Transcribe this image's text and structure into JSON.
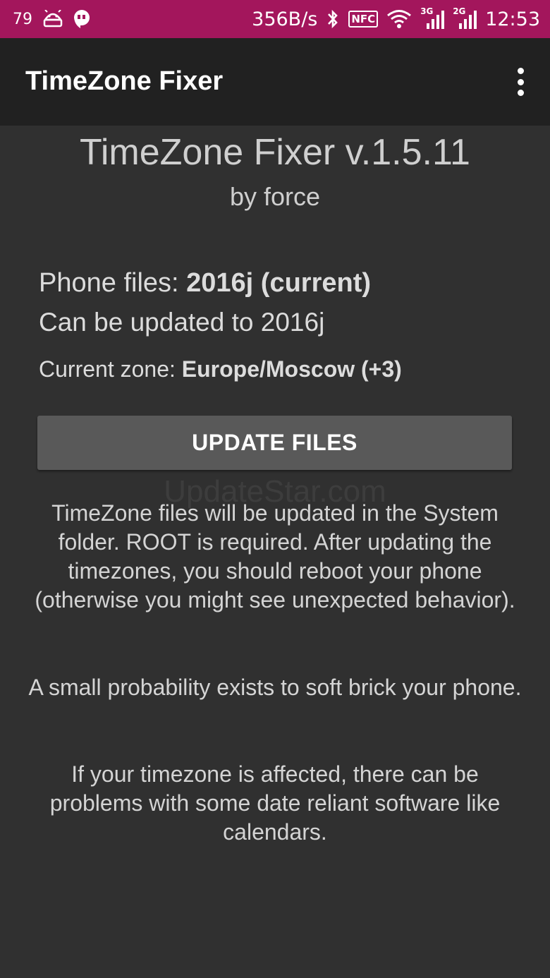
{
  "status_bar": {
    "battery": "79",
    "net_speed": "356B/s",
    "nfc_label": "NFC",
    "sim1_tag": "3G",
    "sim2_tag": "2G",
    "time": "12:53",
    "color": "#a3165c"
  },
  "toolbar": {
    "title": "TimeZone Fixer",
    "overflow_icon": "more-vert-icon"
  },
  "main": {
    "app_heading": "TimeZone Fixer v.1.5.11",
    "app_author": "by force",
    "phone_files_label": "Phone files: ",
    "phone_files_value": "2016j (current)",
    "can_update": "Can be updated to 2016j",
    "current_zone_label": "Current zone: ",
    "current_zone_value": "Europe/Moscow (+3)",
    "update_button": "UPDATE FILES",
    "watermark": "UpdateStar.com",
    "para1": "TimeZone files will be updated in the System folder. ROOT is required. After updating the timezones, you should reboot your phone (otherwise you might see unexpected behavior).",
    "para2": "A small probability exists to soft brick your phone.",
    "para3": "If your timezone is affected, there can be problems with some date reliant software like calendars."
  }
}
